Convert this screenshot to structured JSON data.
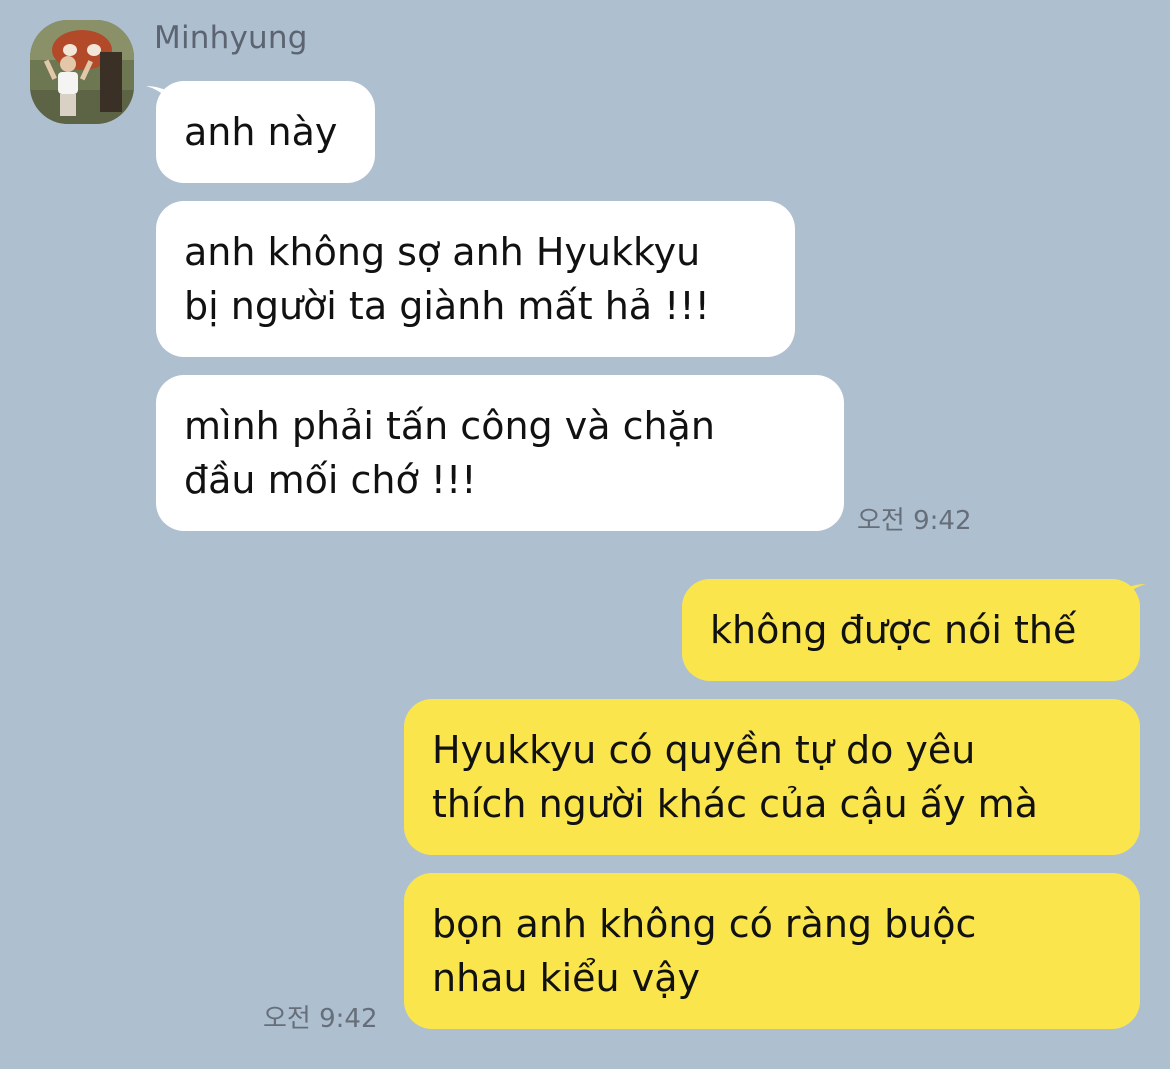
{
  "sender": {
    "name": "Minhyung"
  },
  "received": [
    {
      "lines": [
        "anh này"
      ]
    },
    {
      "lines": [
        "anh không sợ anh Hyukkyu",
        "bị người ta giành mất hả !!!"
      ]
    },
    {
      "lines": [
        "mình phải tấn công và chặn",
        "đầu mối chớ !!!"
      ]
    }
  ],
  "received_time": "오전 9:42",
  "sent": [
    {
      "lines": [
        "không được nói thế"
      ]
    },
    {
      "lines": [
        "Hyukkyu có quyền tự do yêu",
        "thích người khác của cậu ấy mà"
      ]
    },
    {
      "lines": [
        "bọn anh không có ràng buộc",
        "nhau kiểu vậy"
      ]
    }
  ],
  "sent_time": "오전 9:42",
  "colors": {
    "background": "#aebfd0",
    "received_bubble": "#ffffff",
    "sent_bubble": "#fae64c"
  }
}
